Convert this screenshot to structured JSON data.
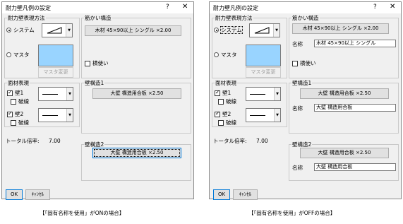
{
  "dialogs": [
    {
      "title": "耐力壁凡例の設定",
      "help_glyph": "?",
      "close_glyph": "✕",
      "display_method_label": "耐力壁表現方法",
      "system_label": "システム",
      "master_label": "マスタ",
      "master_change_label": "マスタ変更",
      "brace_label": "筋かい構造",
      "brace_button": "木材 45×90以上 シングル ×2.00",
      "name_label": "",
      "brace_name": "",
      "yokotsukai_label": "横使い",
      "surface_label": "面材表現",
      "wall1_label": "壁1",
      "wall2_label": "壁2",
      "dashed_label": "破線",
      "wall_struct1_label": "壁構造1",
      "wall_struct1_button": "大壁 構造用合板 ×2.50",
      "wall_struct1_name": "",
      "total_label": "トータル倍率:",
      "total_value": "7.00",
      "wall_struct2_label": "壁構造2",
      "wall_struct2_button": "大壁 構造用合板 ×2.50",
      "wall_struct2_name": "",
      "ok_label": "OK",
      "cancel_label": "ｷｬﾝｾﾙ"
    },
    {
      "title": "耐力壁凡例の設定",
      "help_glyph": "?",
      "close_glyph": "✕",
      "display_method_label": "耐力壁表現方法",
      "system_label": "システム",
      "master_label": "マスタ",
      "master_change_label": "マスタ変更",
      "brace_label": "筋かい構造",
      "brace_button": "木材 45×90以上 シングル ×2.00",
      "name_label": "名称",
      "brace_name": "木材 45×90以上 シングル",
      "yokotsukai_label": "横使い",
      "surface_label": "面材表現",
      "wall1_label": "壁1",
      "wall2_label": "壁2",
      "dashed_label": "破線",
      "wall_struct1_label": "壁構造1",
      "wall_struct1_button": "大壁 構造用合板 ×2.50",
      "wall_struct1_name": "大壁 構造用合板",
      "total_label": "トータル倍率:",
      "total_value": "7.00",
      "wall_struct2_label": "壁構造2",
      "wall_struct2_button": "大壁 構造用合板 ×2.50",
      "wall_struct2_name": "大壁 構造用合板",
      "ok_label": "OK",
      "cancel_label": "ｷｬﾝｾﾙ"
    }
  ],
  "captions": {
    "on_case": "【「固有名称を使用」がONの場合】",
    "off_case": "【「固有名称を使用」がOFFの場合】"
  }
}
